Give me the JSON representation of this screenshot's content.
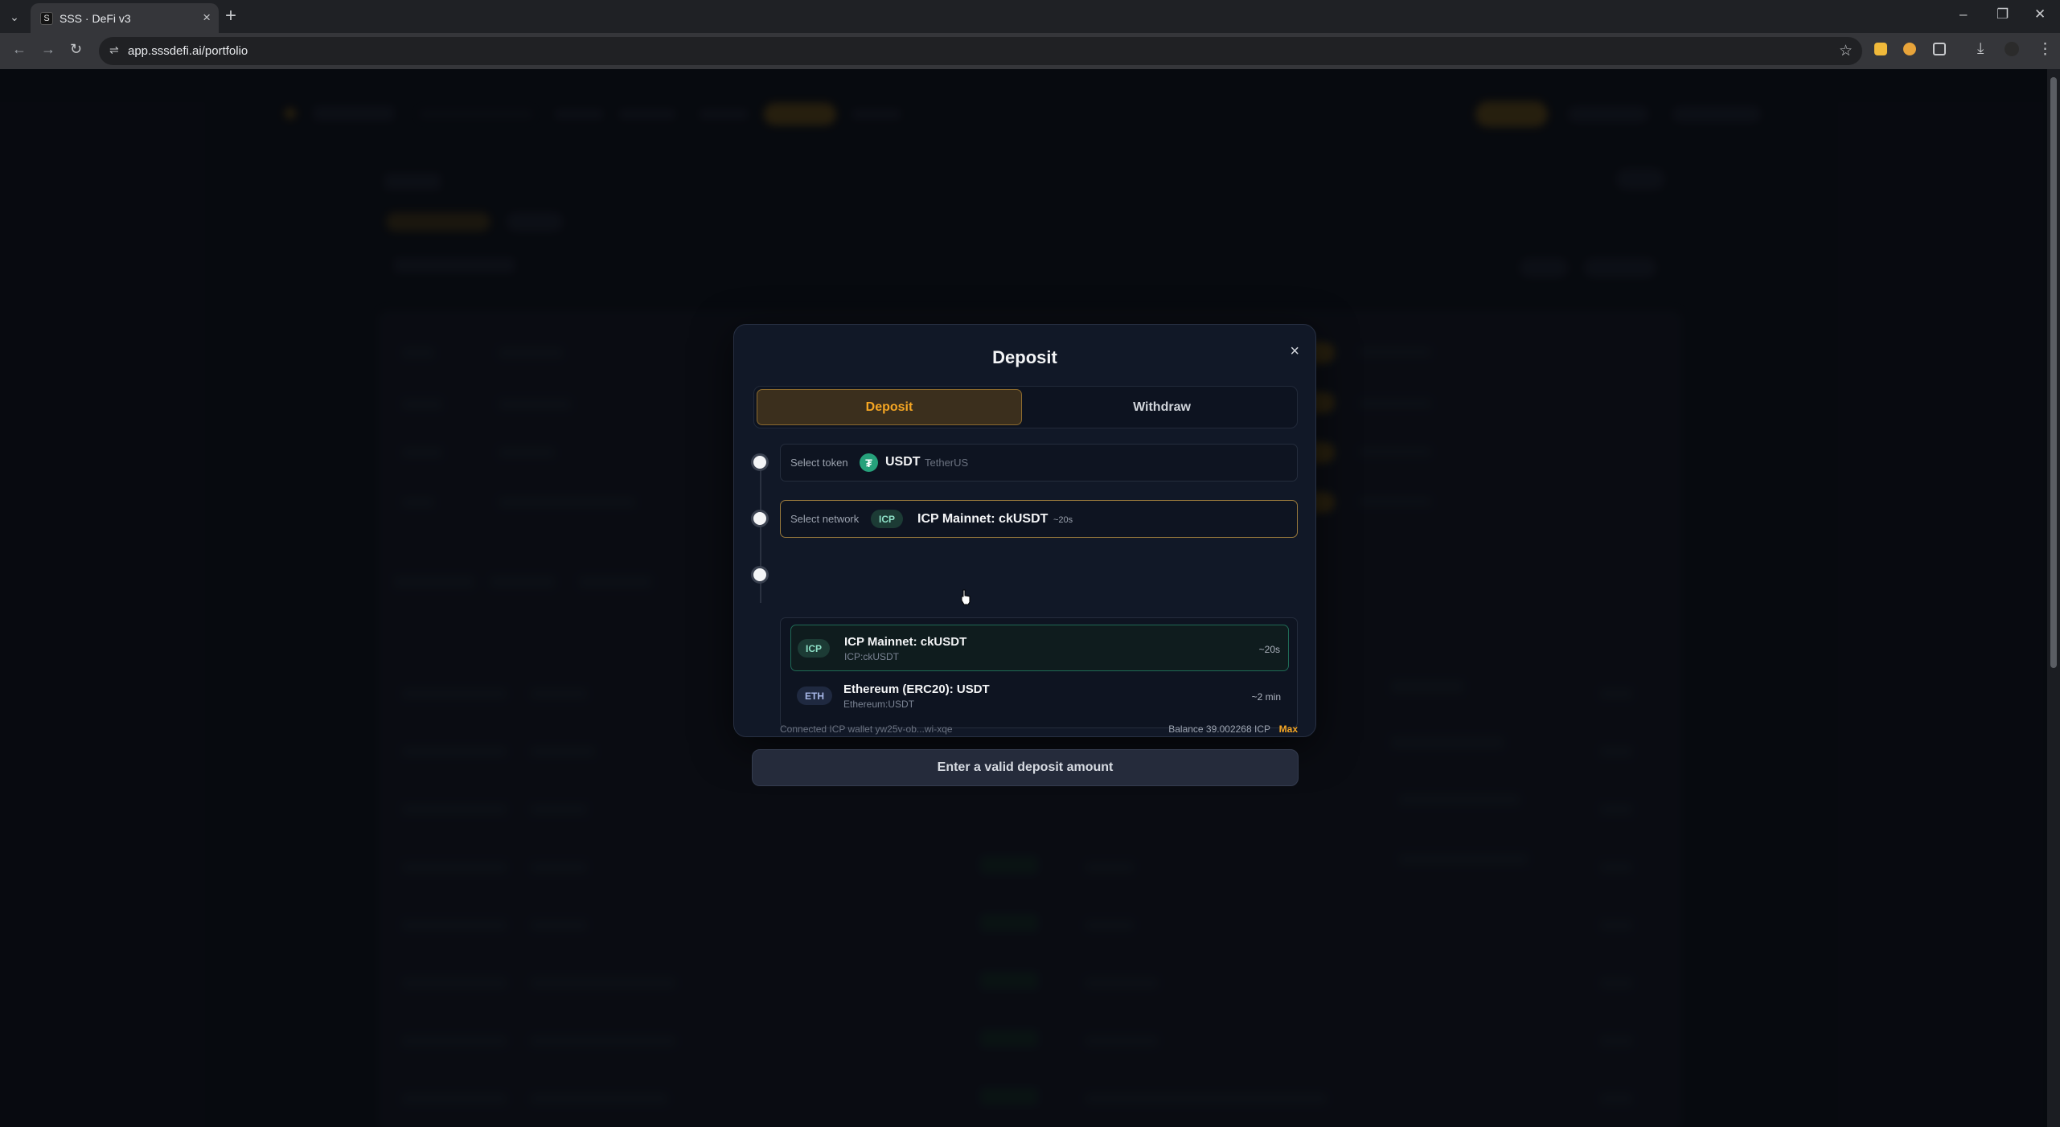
{
  "browser": {
    "tab_title": "SSS · DeFi v3",
    "favicon_letter": "S",
    "url": "app.sssdefi.ai/portfolio",
    "tab_close": "×",
    "new_tab": "+",
    "minimize": "–",
    "restore": "❐",
    "close": "✕",
    "back": "←",
    "forward": "→",
    "reload": "↻",
    "site_info": "⇌",
    "star": "☆",
    "downloads": "⤓",
    "menu": "⋮"
  },
  "modal": {
    "title": "Deposit",
    "close": "×",
    "tabs": {
      "deposit": "Deposit",
      "withdraw": "Withdraw"
    },
    "token_field": {
      "label": "Select token",
      "icon_glyph": "₮",
      "symbol": "USDT",
      "name": "TetherUS"
    },
    "network_field": {
      "label": "Select network",
      "chip": "ICP",
      "name": "ICP Mainnet: ckUSDT",
      "time": "~20s"
    },
    "network_options": [
      {
        "chip": "ICP",
        "title": "ICP Mainnet: ckUSDT",
        "subtitle": "ICP:ckUSDT",
        "time": "~20s"
      },
      {
        "chip": "ETH",
        "title": "Ethereum (ERC20): USDT",
        "subtitle": "Ethereum:USDT",
        "time": "~2 min"
      }
    ],
    "wallet": "Connected ICP wallet yw25v-ob...wi-xqe",
    "balance": "Balance 39.002268 ICP",
    "max": "Max",
    "submit": "Enter a valid deposit amount"
  },
  "colors": {
    "accent": "#f5a623",
    "tether": "#26a17b",
    "modal_bg": "#111827"
  }
}
